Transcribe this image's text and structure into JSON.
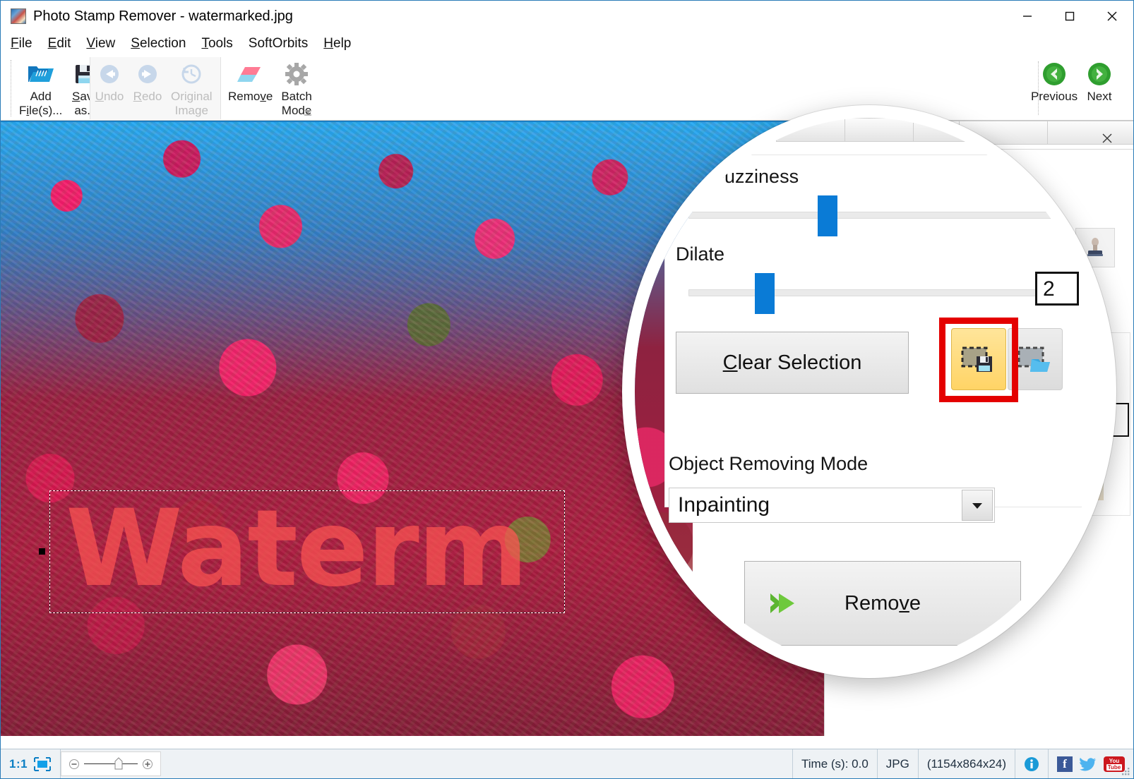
{
  "window": {
    "title": "Photo Stamp Remover - watermarked.jpg",
    "app_icon": "photo-stamp-remover-icon",
    "minimize": "minimize-icon",
    "maximize": "maximize-icon",
    "close": "close-icon"
  },
  "menu": [
    {
      "label": "File",
      "accel": "F"
    },
    {
      "label": "Edit",
      "accel": "E"
    },
    {
      "label": "View",
      "accel": "V"
    },
    {
      "label": "Selection",
      "accel": "S"
    },
    {
      "label": "Tools",
      "accel": "T"
    },
    {
      "label": "SoftOrbits",
      "accel": ""
    },
    {
      "label": "Help",
      "accel": "H"
    }
  ],
  "toolbar": {
    "buttons": [
      {
        "label": "Add\nFile(s)...",
        "icon": "open-folder-icon",
        "enabled": true,
        "accel": "i"
      },
      {
        "label": "Save\nas...",
        "icon": "floppy-save-icon",
        "enabled": true,
        "accel": "S"
      },
      {
        "label": "Undo",
        "icon": "undo-arrow-icon",
        "enabled": false,
        "accel": "U"
      },
      {
        "label": "Redo",
        "icon": "redo-arrow-icon",
        "enabled": false,
        "accel": "R"
      },
      {
        "label": "Original\nImage",
        "icon": "clock-history-icon",
        "enabled": false,
        "accel": ""
      },
      {
        "label": "Remove",
        "icon": "eraser-icon",
        "enabled": true,
        "accel": "v"
      },
      {
        "label": "Batch\nMode",
        "icon": "gear-icon",
        "enabled": true,
        "accel": ""
      }
    ],
    "expand": "ribbon-expand-icon",
    "nav": [
      {
        "label": "Previous",
        "icon": "green-left-arrow-icon"
      },
      {
        "label": "Next",
        "icon": "green-right-arrow-icon"
      }
    ]
  },
  "canvas": {
    "watermark_text": "Waterm",
    "selection": "dashed-selection-rectangle"
  },
  "right_panel": {
    "close": "panel-close-icon",
    "stamp_tool": "stamp-tool-icon"
  },
  "magnifier": {
    "color_fuzziness": {
      "label": "olor Fuzziness",
      "slider_pct": 40
    },
    "dilate": {
      "label": "Dilate",
      "slider_pct": 21,
      "value": "2"
    },
    "clear_selection": {
      "label": "Clear Selection",
      "accel": "C"
    },
    "save_selection_button": {
      "icon": "save-selection-icon",
      "state": "on"
    },
    "load_selection_button": {
      "icon": "load-selection-icon",
      "state": "off"
    },
    "highlight": "red-highlight-box",
    "object_removing_mode": {
      "label": "Object Removing Mode",
      "value": "Inpainting",
      "arrow": "chevron-down-icon"
    },
    "remove_button": {
      "label": "Remove",
      "accel": "v",
      "icon": "green-double-arrow-icon"
    }
  },
  "statusbar": {
    "ratio": "1:1",
    "fit_icon": "fit-to-window-icon",
    "zoom_minus": "zoom-out-icon",
    "zoom_plus": "zoom-in-icon",
    "time": "Time (s): 0.0",
    "format": "JPG",
    "dimensions": "(1154x864x24)",
    "info_icon": "info-icon",
    "facebook": "f",
    "facebook_icon": "facebook-icon",
    "twitter_icon": "twitter-icon",
    "youtube_top": "You",
    "youtube_bottom": "Tube",
    "youtube_icon": "youtube-icon"
  },
  "colors": {
    "accent_blue": "#0a7bd6",
    "highlight_red": "#e40000",
    "toggle_yellow": "#ffd466",
    "green": "#6fbf3f",
    "watermark": "#ff5652"
  }
}
